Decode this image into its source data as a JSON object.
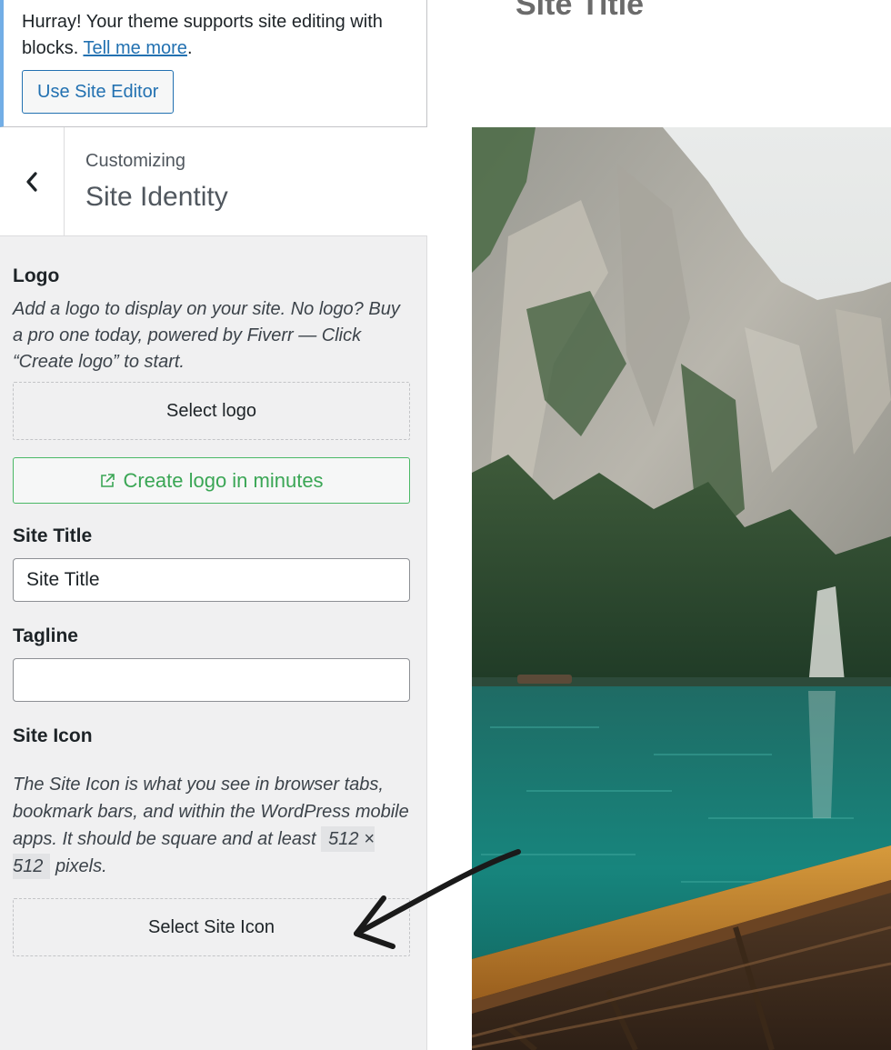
{
  "notice": {
    "text_prefix": "Hurray! Your theme supports site editing with blocks.",
    "link_text": "Tell me more",
    "text_suffix": ".",
    "button_label": "Use Site Editor"
  },
  "header": {
    "breadcrumb": "Customizing",
    "title": "Site Identity",
    "back_icon": "chevron-left-icon"
  },
  "logo": {
    "label": "Logo",
    "description": "Add a logo to display on your site. No logo? Buy a pro one today, powered by Fiverr — Click “Create logo” to start.",
    "select_label": "Select logo",
    "create_label": "Create logo in minutes",
    "create_icon": "external-link-icon"
  },
  "site_title": {
    "label": "Site Title",
    "value": "Site Title"
  },
  "tagline": {
    "label": "Tagline",
    "value": ""
  },
  "site_icon": {
    "label": "Site Icon",
    "description": "The Site Icon is what you see in browser tabs, bookmark bars, and within the WordPress mobile apps. It should be square and at least",
    "size": "512 × 512",
    "description_suffix": "pixels.",
    "select_label": "Select Site Icon"
  },
  "preview": {
    "site_title": "Site Title"
  },
  "colors": {
    "accent_blue": "#2271b1",
    "notice_border": "#72aee6",
    "fiverr_green": "#4ab866",
    "sidebar_bg": "#f0f0f1"
  }
}
